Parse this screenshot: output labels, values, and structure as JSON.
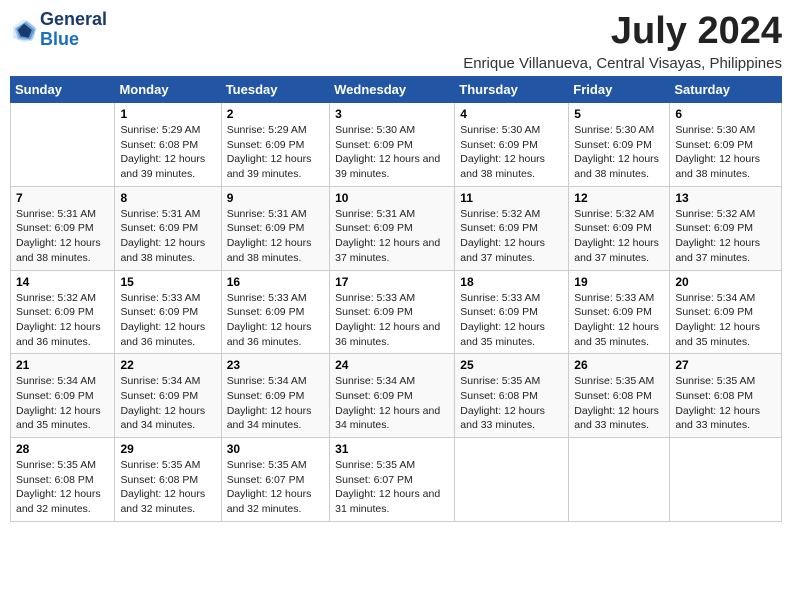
{
  "logo": {
    "line1": "General",
    "line2": "Blue"
  },
  "title": "July 2024",
  "subtitle": "Enrique Villanueva, Central Visayas, Philippines",
  "weekdays": [
    "Sunday",
    "Monday",
    "Tuesday",
    "Wednesday",
    "Thursday",
    "Friday",
    "Saturday"
  ],
  "weeks": [
    [
      {
        "date": "",
        "info": ""
      },
      {
        "date": "1",
        "info": "Sunrise: 5:29 AM\nSunset: 6:08 PM\nDaylight: 12 hours\nand 39 minutes."
      },
      {
        "date": "2",
        "info": "Sunrise: 5:29 AM\nSunset: 6:09 PM\nDaylight: 12 hours\nand 39 minutes."
      },
      {
        "date": "3",
        "info": "Sunrise: 5:30 AM\nSunset: 6:09 PM\nDaylight: 12 hours\nand 39 minutes."
      },
      {
        "date": "4",
        "info": "Sunrise: 5:30 AM\nSunset: 6:09 PM\nDaylight: 12 hours\nand 38 minutes."
      },
      {
        "date": "5",
        "info": "Sunrise: 5:30 AM\nSunset: 6:09 PM\nDaylight: 12 hours\nand 38 minutes."
      },
      {
        "date": "6",
        "info": "Sunrise: 5:30 AM\nSunset: 6:09 PM\nDaylight: 12 hours\nand 38 minutes."
      }
    ],
    [
      {
        "date": "7",
        "info": "Sunrise: 5:31 AM\nSunset: 6:09 PM\nDaylight: 12 hours\nand 38 minutes."
      },
      {
        "date": "8",
        "info": "Sunrise: 5:31 AM\nSunset: 6:09 PM\nDaylight: 12 hours\nand 38 minutes."
      },
      {
        "date": "9",
        "info": "Sunrise: 5:31 AM\nSunset: 6:09 PM\nDaylight: 12 hours\nand 38 minutes."
      },
      {
        "date": "10",
        "info": "Sunrise: 5:31 AM\nSunset: 6:09 PM\nDaylight: 12 hours\nand 37 minutes."
      },
      {
        "date": "11",
        "info": "Sunrise: 5:32 AM\nSunset: 6:09 PM\nDaylight: 12 hours\nand 37 minutes."
      },
      {
        "date": "12",
        "info": "Sunrise: 5:32 AM\nSunset: 6:09 PM\nDaylight: 12 hours\nand 37 minutes."
      },
      {
        "date": "13",
        "info": "Sunrise: 5:32 AM\nSunset: 6:09 PM\nDaylight: 12 hours\nand 37 minutes."
      }
    ],
    [
      {
        "date": "14",
        "info": "Sunrise: 5:32 AM\nSunset: 6:09 PM\nDaylight: 12 hours\nand 36 minutes."
      },
      {
        "date": "15",
        "info": "Sunrise: 5:33 AM\nSunset: 6:09 PM\nDaylight: 12 hours\nand 36 minutes."
      },
      {
        "date": "16",
        "info": "Sunrise: 5:33 AM\nSunset: 6:09 PM\nDaylight: 12 hours\nand 36 minutes."
      },
      {
        "date": "17",
        "info": "Sunrise: 5:33 AM\nSunset: 6:09 PM\nDaylight: 12 hours\nand 36 minutes."
      },
      {
        "date": "18",
        "info": "Sunrise: 5:33 AM\nSunset: 6:09 PM\nDaylight: 12 hours\nand 35 minutes."
      },
      {
        "date": "19",
        "info": "Sunrise: 5:33 AM\nSunset: 6:09 PM\nDaylight: 12 hours\nand 35 minutes."
      },
      {
        "date": "20",
        "info": "Sunrise: 5:34 AM\nSunset: 6:09 PM\nDaylight: 12 hours\nand 35 minutes."
      }
    ],
    [
      {
        "date": "21",
        "info": "Sunrise: 5:34 AM\nSunset: 6:09 PM\nDaylight: 12 hours\nand 35 minutes."
      },
      {
        "date": "22",
        "info": "Sunrise: 5:34 AM\nSunset: 6:09 PM\nDaylight: 12 hours\nand 34 minutes."
      },
      {
        "date": "23",
        "info": "Sunrise: 5:34 AM\nSunset: 6:09 PM\nDaylight: 12 hours\nand 34 minutes."
      },
      {
        "date": "24",
        "info": "Sunrise: 5:34 AM\nSunset: 6:09 PM\nDaylight: 12 hours\nand 34 minutes."
      },
      {
        "date": "25",
        "info": "Sunrise: 5:35 AM\nSunset: 6:08 PM\nDaylight: 12 hours\nand 33 minutes."
      },
      {
        "date": "26",
        "info": "Sunrise: 5:35 AM\nSunset: 6:08 PM\nDaylight: 12 hours\nand 33 minutes."
      },
      {
        "date": "27",
        "info": "Sunrise: 5:35 AM\nSunset: 6:08 PM\nDaylight: 12 hours\nand 33 minutes."
      }
    ],
    [
      {
        "date": "28",
        "info": "Sunrise: 5:35 AM\nSunset: 6:08 PM\nDaylight: 12 hours\nand 32 minutes."
      },
      {
        "date": "29",
        "info": "Sunrise: 5:35 AM\nSunset: 6:08 PM\nDaylight: 12 hours\nand 32 minutes."
      },
      {
        "date": "30",
        "info": "Sunrise: 5:35 AM\nSunset: 6:07 PM\nDaylight: 12 hours\nand 32 minutes."
      },
      {
        "date": "31",
        "info": "Sunrise: 5:35 AM\nSunset: 6:07 PM\nDaylight: 12 hours\nand 31 minutes."
      },
      {
        "date": "",
        "info": ""
      },
      {
        "date": "",
        "info": ""
      },
      {
        "date": "",
        "info": ""
      }
    ]
  ]
}
